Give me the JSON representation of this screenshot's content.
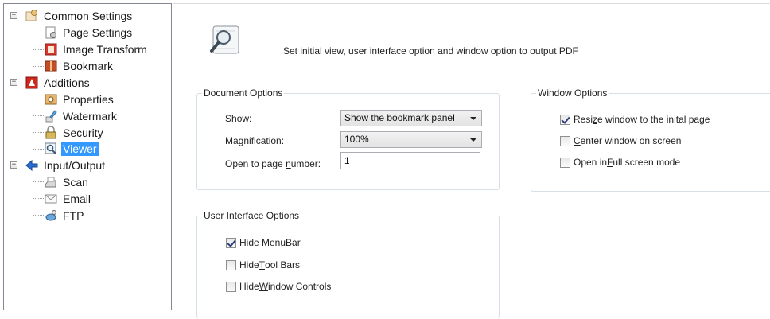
{
  "tree": {
    "items": [
      {
        "label": "Common Settings",
        "icon": "settings-icon"
      },
      {
        "label": "Page Settings",
        "icon": "page-settings-icon"
      },
      {
        "label": "Image Transform",
        "icon": "image-transform-icon"
      },
      {
        "label": "Bookmark",
        "icon": "bookmark-icon"
      },
      {
        "label": "Additions",
        "icon": "pdf-icon"
      },
      {
        "label": "Properties",
        "icon": "properties-icon"
      },
      {
        "label": "Watermark",
        "icon": "watermark-icon"
      },
      {
        "label": "Security",
        "icon": "lock-icon"
      },
      {
        "label": "Viewer",
        "icon": "viewer-icon"
      },
      {
        "label": "Input/Output",
        "icon": "arrow-icon"
      },
      {
        "label": "Scan",
        "icon": "scanner-icon"
      },
      {
        "label": "Email",
        "icon": "envelope-icon"
      },
      {
        "label": "FTP",
        "icon": "globe-icon"
      }
    ],
    "selected": "Viewer",
    "expander_symbol": "−"
  },
  "header": {
    "description": "Set initial view, user interface option and window option to output PDF",
    "icon": "magnifier-icon"
  },
  "document_options": {
    "title": "Document Options",
    "show_label_pre": "S",
    "show_label_u": "h",
    "show_label_post": "ow:",
    "show_value": "Show the bookmark panel",
    "mag_label_pre": "Ma",
    "mag_label_u": "g",
    "mag_label_post": "nification:",
    "mag_value": "100%",
    "open_label_pre": "Open to page ",
    "open_label_u": "n",
    "open_label_post": "umber:",
    "open_value": "1"
  },
  "window_options": {
    "title": "Window Options",
    "items": [
      {
        "pre": "Resi",
        "u": "z",
        "post": "e window to the inital page",
        "checked": true
      },
      {
        "pre": "",
        "u": "C",
        "post": "enter window on screen",
        "checked": false
      },
      {
        "pre": "Open in ",
        "u": "F",
        "post": "ull screen mode",
        "checked": false
      }
    ]
  },
  "ui_options": {
    "title": "User Interface Options",
    "items": [
      {
        "pre": "Hide Men",
        "u": "u",
        "post": " Bar",
        "checked": true
      },
      {
        "pre": "Hide ",
        "u": "T",
        "post": "ool Bars",
        "checked": false
      },
      {
        "pre": "Hide ",
        "u": "W",
        "post": "indow Controls",
        "checked": false
      }
    ]
  },
  "colors": {
    "selection": "#3399ff",
    "group_border": "#d5dfe5",
    "check": "#2a3b78"
  }
}
